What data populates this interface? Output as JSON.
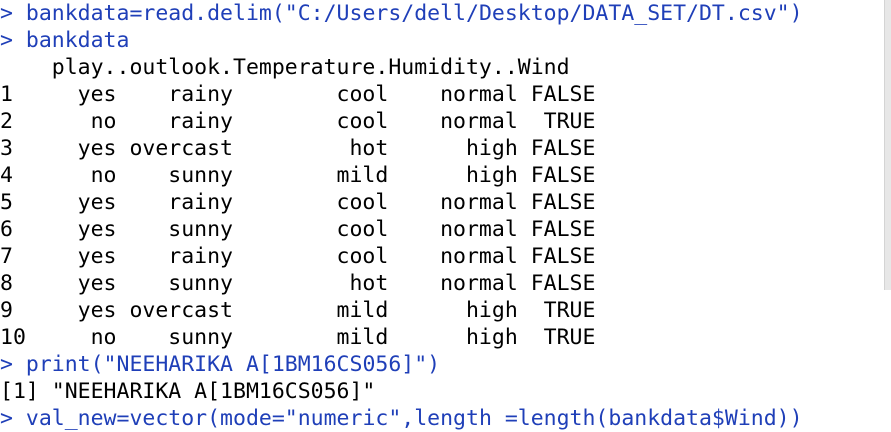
{
  "console": {
    "prompt": ">",
    "cmd1": " bankdata=read.delim(\"C:/Users/dell/Desktop/DATA_SET/DT.csv\")",
    "cmd2": " bankdata",
    "header": "    play..outlook.Temperature.Humidity..Wind",
    "rows": [
      "1     yes    rainy        cool    normal FALSE",
      "2      no    rainy        cool    normal  TRUE",
      "3     yes overcast         hot      high FALSE",
      "4      no    sunny        mild      high FALSE",
      "5     yes    rainy        cool    normal FALSE",
      "6     yes    sunny        cool    normal FALSE",
      "7     yes    rainy        cool    normal FALSE",
      "8     yes    sunny         hot    normal FALSE",
      "9     yes overcast        mild      high  TRUE",
      "10     no    sunny        mild      high  TRUE"
    ],
    "cmd3": " print(\"NEEHARIKA A[1BM16CS056]\")",
    "out3": "[1] \"NEEHARIKA A[1BM16CS056]\"",
    "cmd4": " val_new=vector(mode=\"numeric\",length =length(bankdata$Wind))"
  }
}
